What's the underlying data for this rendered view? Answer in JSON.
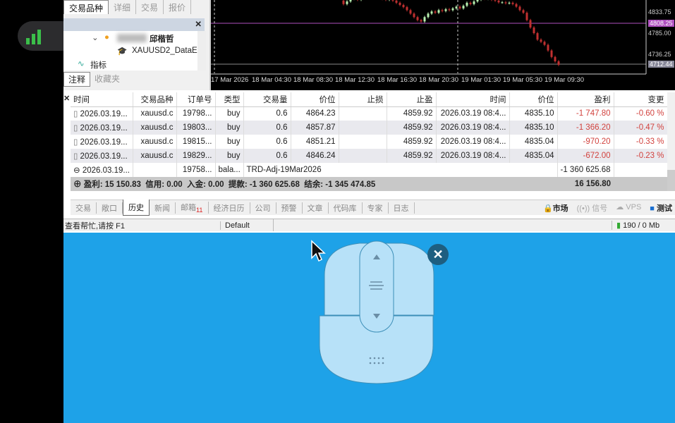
{
  "navigator": {
    "tabs": [
      "交易品种",
      "详细",
      "交易",
      "报价"
    ],
    "account_name": "邱楷哲",
    "server": "XAUUSD2_DataE",
    "indicators": "指标",
    "bottom_tabs": [
      "注释",
      "收藏夹"
    ]
  },
  "chart": {
    "price_labels": [
      "4833.75",
      "4808.25",
      "4785.00",
      "4736.25",
      "4712.44"
    ],
    "time_labels": [
      "17 Mar 2026",
      "18 Mar 04:30",
      "18 Mar 08:30",
      "18 Mar 12:30",
      "18 Mar 16:30",
      "18 Mar 20:30",
      "19 Mar 01:30",
      "19 Mar 05:30",
      "19 Mar 09:30"
    ],
    "closes": [
      4860,
      4852,
      4858,
      4864,
      4866,
      4862,
      4868,
      4865,
      4870,
      4866,
      4872,
      4868,
      4864,
      4862,
      4868,
      4860,
      4855,
      4850,
      4845,
      4838,
      4830,
      4822,
      4815,
      4812,
      4822,
      4830,
      4835,
      4832,
      4838,
      4836,
      4840,
      4838,
      4842,
      4846,
      4842,
      4848,
      4855,
      4852,
      4858,
      4862,
      4866,
      4864,
      4868,
      4862,
      4860,
      4856,
      4856,
      4854,
      4855,
      4852,
      4846,
      4838,
      4832,
      4815,
      4798,
      4785,
      4770,
      4765,
      4758,
      4745,
      4730,
      4720,
      4712
    ]
  },
  "table": {
    "headers": [
      "时间",
      "交易品种",
      "订单号",
      "类型",
      "交易量",
      "价位",
      "止损",
      "止盈",
      "时间",
      "价位",
      "盈利",
      "变更"
    ],
    "rows": [
      [
        "2026.03.19...",
        "xauusd.c",
        "19798...",
        "buy",
        "0.6",
        "4864.23",
        "",
        "4859.92",
        "2026.03.19 08:4...",
        "4835.10",
        "-1 747.80",
        "-0.60 %"
      ],
      [
        "2026.03.19...",
        "xauusd.c",
        "19803...",
        "buy",
        "0.6",
        "4857.87",
        "",
        "4859.92",
        "2026.03.19 08:4...",
        "4835.10",
        "-1 366.20",
        "-0.47 %"
      ],
      [
        "2026.03.19...",
        "xauusd.c",
        "19815...",
        "buy",
        "0.6",
        "4851.21",
        "",
        "4859.92",
        "2026.03.19 08:4...",
        "4835.04",
        "-970.20",
        "-0.33 %"
      ],
      [
        "2026.03.19...",
        "xauusd.c",
        "19829...",
        "buy",
        "0.6",
        "4846.24",
        "",
        "4859.92",
        "2026.03.19 08:4...",
        "4835.04",
        "-672.00",
        "-0.23 %"
      ]
    ],
    "balance": {
      "time": "2026.03.19...",
      "order": "19758...",
      "type": "bala...",
      "comment": "TRD-Adj-19Mar2026",
      "profit": "-1 360 625.68"
    },
    "summary": {
      "text": "盈利: 15 150.83  信用: 0.00  入金: 0.00  提款: -1 360 625.68  结余: -1 345 474.85",
      "total": "16 156.80"
    }
  },
  "tabs": [
    "交易",
    "敞口",
    "历史",
    "新闻",
    "邮箱",
    "经济日历",
    "公司",
    "预警",
    "文章",
    "代码库",
    "专家",
    "日志"
  ],
  "mail_count": "11",
  "right_tabs": [
    "市场",
    "信号",
    "VPS",
    "测试"
  ],
  "status": {
    "help": "查看帮忙,请按 F1",
    "profile": "Default",
    "traffic": "190 / 0 Mb"
  },
  "colors": {
    "loss": "#d2423e",
    "overlay": "#1ea2e8"
  }
}
